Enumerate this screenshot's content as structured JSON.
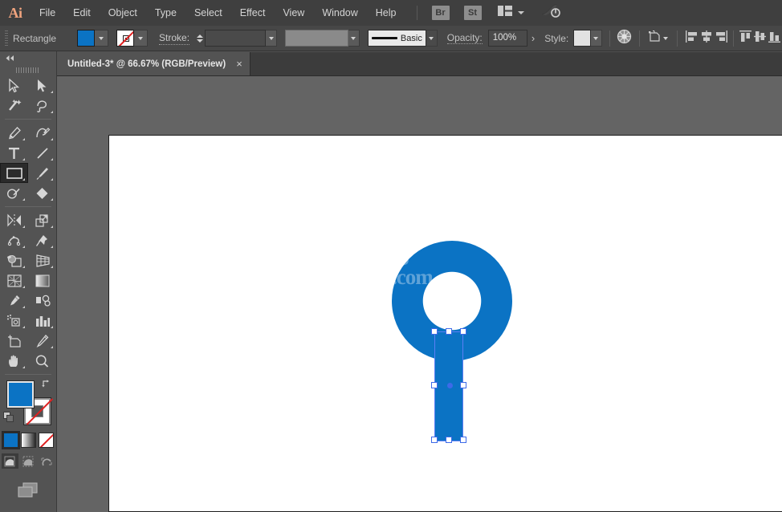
{
  "app": {
    "name": "Adobe Illustrator",
    "logo": "Ai"
  },
  "menubar": {
    "items": [
      {
        "label": "File"
      },
      {
        "label": "Edit"
      },
      {
        "label": "Object"
      },
      {
        "label": "Type"
      },
      {
        "label": "Select"
      },
      {
        "label": "Effect"
      },
      {
        "label": "View"
      },
      {
        "label": "Window"
      },
      {
        "label": "Help"
      }
    ],
    "bridge_label": "Br",
    "stock_label": "St",
    "workspace_icon": "workspace-switcher-icon",
    "rocket_icon": "rocket-launch-icon"
  },
  "controlbar": {
    "object_label": "Rectangle",
    "fill_color": "#0b73c4",
    "stroke_color": "none",
    "stroke_label": "Stroke:",
    "stroke_weight": "",
    "stroke_profile_label": "Basic",
    "opacity_label": "Opacity:",
    "opacity_value": "100%",
    "style_label": "Style:",
    "recolor_icon": "recolor-artwork-icon",
    "transform_icon": "transform-icon",
    "align_icons": [
      "align-left-icon",
      "align-horizontal-center-icon",
      "align-right-icon",
      "align-top-icon",
      "align-vertical-center-icon",
      "align-bottom-icon"
    ]
  },
  "tabbar": {
    "tab_title": "Untitled-3* @ 66.67% (RGB/Preview)",
    "close_label": "×"
  },
  "toolbar": {
    "collapse_label": "◀◀",
    "tools": [
      {
        "name": "selection-tool",
        "selected": false
      },
      {
        "name": "direct-selection-tool",
        "selected": false
      },
      {
        "name": "magic-wand-tool",
        "selected": false
      },
      {
        "name": "lasso-tool",
        "selected": false
      },
      {
        "name": "pen-tool",
        "selected": false
      },
      {
        "name": "curvature-tool",
        "selected": false
      },
      {
        "name": "type-tool",
        "selected": false
      },
      {
        "name": "line-segment-tool",
        "selected": false
      },
      {
        "name": "rectangle-tool",
        "selected": true
      },
      {
        "name": "paintbrush-tool",
        "selected": false
      },
      {
        "name": "shaper-tool",
        "selected": false
      },
      {
        "name": "eraser-tool",
        "selected": false
      },
      {
        "name": "rotate-tool",
        "selected": false
      },
      {
        "name": "scale-tool",
        "selected": false
      },
      {
        "name": "width-tool",
        "selected": false
      },
      {
        "name": "free-transform-tool",
        "selected": false
      },
      {
        "name": "shape-builder-tool",
        "selected": false
      },
      {
        "name": "perspective-grid-tool",
        "selected": false
      },
      {
        "name": "mesh-tool",
        "selected": false
      },
      {
        "name": "gradient-tool",
        "selected": false
      },
      {
        "name": "eyedropper-tool",
        "selected": false
      },
      {
        "name": "blend-tool",
        "selected": false
      },
      {
        "name": "symbol-sprayer-tool",
        "selected": false
      },
      {
        "name": "column-graph-tool",
        "selected": false
      },
      {
        "name": "artboard-tool",
        "selected": false
      },
      {
        "name": "slice-tool",
        "selected": false
      },
      {
        "name": "hand-tool",
        "selected": false
      },
      {
        "name": "zoom-tool",
        "selected": false
      }
    ],
    "fill_color": "#0b73c4",
    "stroke_color": "none",
    "color_modes": [
      {
        "name": "color-mode-button",
        "selected": true
      },
      {
        "name": "gradient-mode-button",
        "selected": false
      },
      {
        "name": "none-mode-button",
        "selected": false
      }
    ],
    "draw_modes": [
      {
        "name": "draw-normal-button",
        "selected": true
      },
      {
        "name": "draw-behind-button",
        "selected": false
      },
      {
        "name": "draw-inside-button",
        "selected": false
      }
    ],
    "screen_mode": "change-screen-mode-button"
  },
  "canvas": {
    "artboard_background": "#ffffff",
    "artwork": {
      "shape_color": "#0b73c4",
      "ring_name": "blue-ring-shape",
      "rect_name": "blue-rectangle-shape",
      "selection_color": "#3d6ae8"
    },
    "watermark_line1": "J",
    "watermark_line2": ".com"
  }
}
